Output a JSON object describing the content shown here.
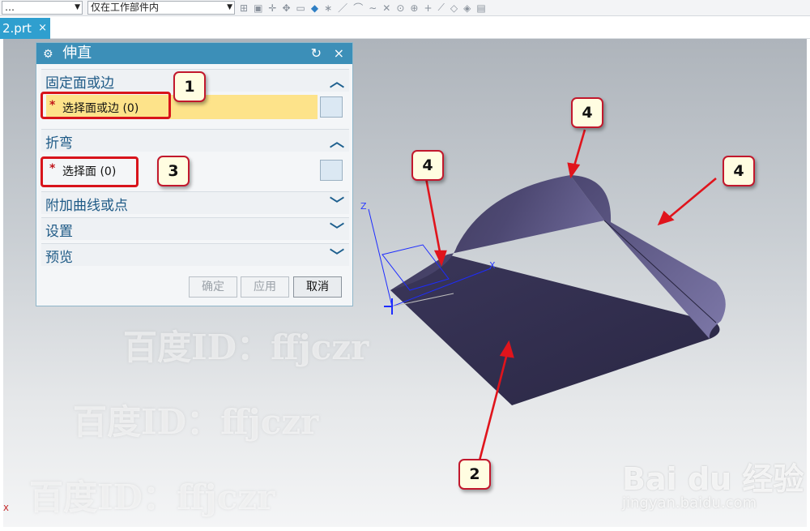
{
  "toolbar": {
    "combo1_value": "…",
    "combo2_value": "仅在工作部件内",
    "icons": [
      "snap-point-icon",
      "filter-icon",
      "select-icon",
      "view-icon",
      "face-icon"
    ]
  },
  "tab": {
    "label": "2.prt",
    "close_symbol": "×"
  },
  "dialog": {
    "title": "伸直",
    "reset_symbol": "↻",
    "close_symbol": "×",
    "section_fixed": "固定面或边",
    "select_fixed": "选择面或边 (0)",
    "section_bend": "折弯",
    "select_face": "选择面 (0)",
    "section_curve": "附加曲线或点",
    "section_settings": "设置",
    "section_preview": "预览",
    "required_mark": "*",
    "btn_ok": "确定",
    "btn_apply": "应用",
    "btn_cancel": "取消"
  },
  "annotations": {
    "n1": "1",
    "n2": "2",
    "n3": "3",
    "n4a": "4",
    "n4b": "4",
    "n4c": "4"
  },
  "watermark": {
    "text1": "百度ID：ffjczr",
    "text2": "百度ID：ffjczr",
    "text3": "百度ID：ffjczr",
    "brand": "Bai du 经验",
    "brand_url": "jingyan.baidu.com"
  },
  "triad": {
    "z_label": "Z",
    "x_label": "X",
    "corner_label": "X"
  },
  "colors": {
    "title_bar": "#3c8fb8",
    "highlight": "#fde38a",
    "part": "#2f2c4a",
    "callout": "#d8141b"
  }
}
